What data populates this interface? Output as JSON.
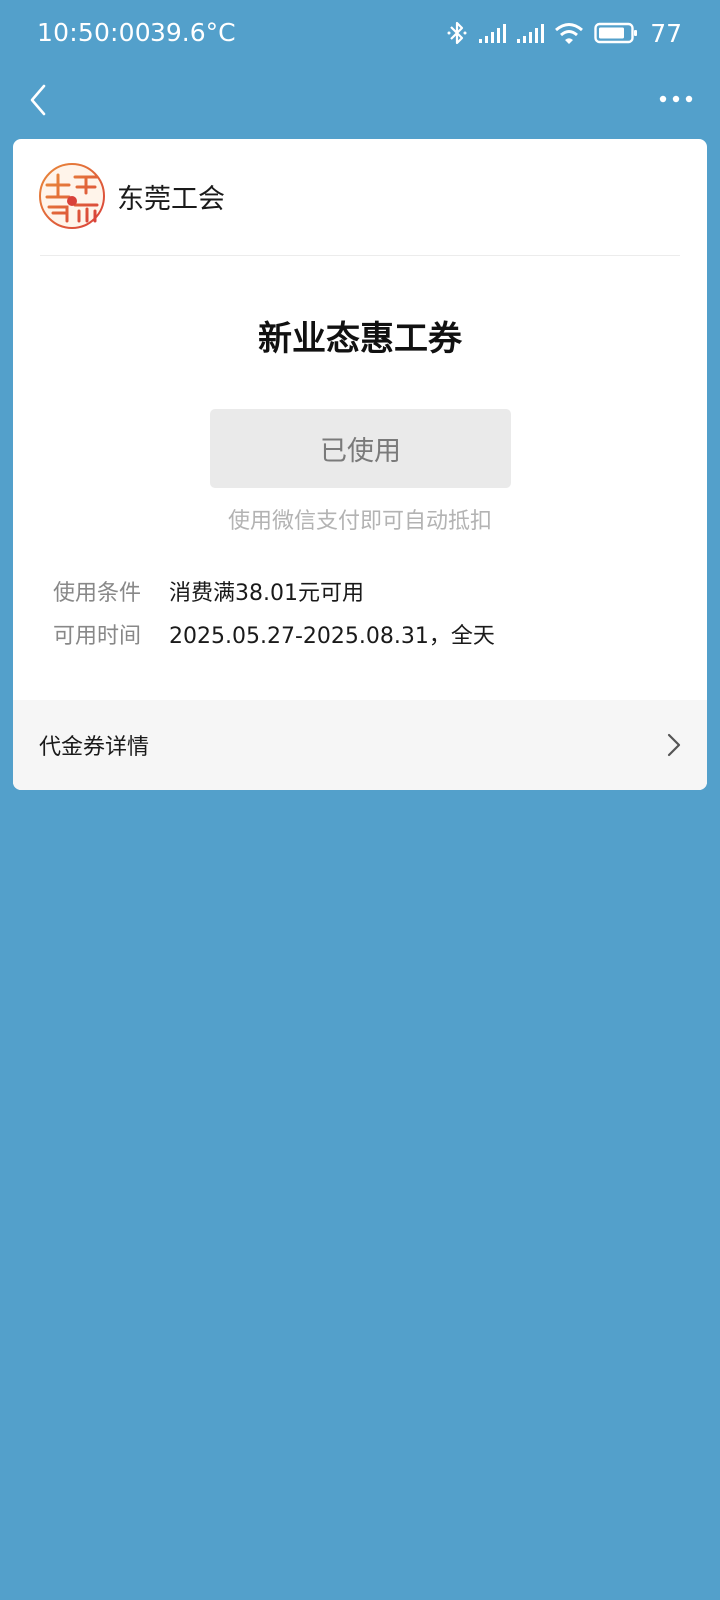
{
  "status_bar": {
    "time": "10:50:00",
    "temperature": "39.6°C",
    "battery": "77",
    "icons": [
      "bluetooth-icon",
      "signal-icon",
      "signal-icon",
      "wifi-icon",
      "battery-icon"
    ]
  },
  "nav": {
    "back_icon": "chevron-left-icon",
    "more_icon": "more-dots-icon"
  },
  "merchant": {
    "name": "东莞工会",
    "logo_icon": "union-logo-icon"
  },
  "coupon": {
    "title": "新业态惠工券",
    "status_button": "已使用",
    "hint": "使用微信支付即可自动抵扣",
    "rows": [
      {
        "label": "使用条件",
        "value": "消费满38.01元可用"
      },
      {
        "label": "可用时间",
        "value": "2025.05.27-2025.08.31，全天"
      }
    ]
  },
  "detail": {
    "label": "代金券详情",
    "arrow_icon": "chevron-right-icon"
  },
  "colors": {
    "background": "#53a0cb",
    "card": "#ffffff",
    "button_bg": "#eaeaea",
    "logo_red": "#d9413a",
    "logo_orange": "#e98a3a"
  }
}
